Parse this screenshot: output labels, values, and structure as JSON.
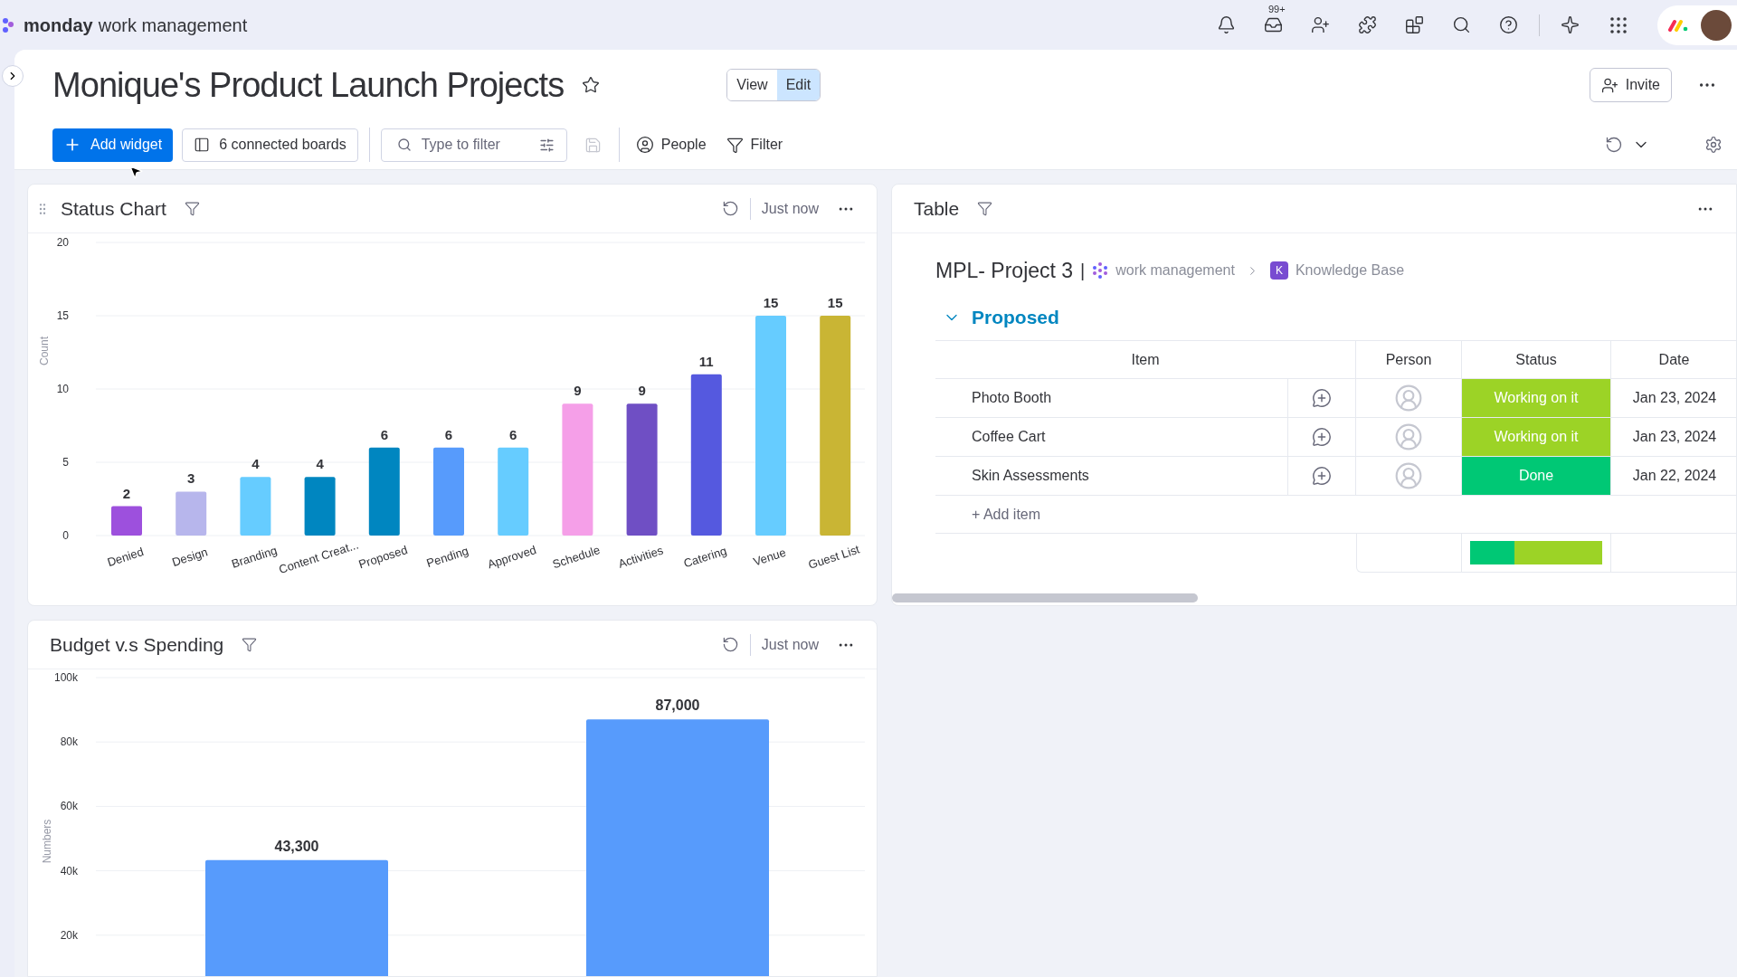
{
  "app": {
    "logo_bold": "monday",
    "logo_rest": "work management",
    "inbox_badge": "99+"
  },
  "board": {
    "title": "Monique's Product Launch Projects",
    "starred": false,
    "view_modes": [
      {
        "label": "View",
        "selected": false
      },
      {
        "label": "Edit",
        "selected": true
      }
    ],
    "invite": "Invite"
  },
  "toolbar": {
    "add_widget": "Add widget",
    "connected_boards": "6 connected boards",
    "filter_field": {
      "placeholder": "Type to filter"
    },
    "people": "People",
    "filter": "Filter"
  },
  "status_widget": {
    "title": "Status Chart",
    "updated": "Just now",
    "bars": [
      {
        "color": "#9d50dd"
      },
      {
        "color": "#b7b6ec"
      },
      {
        "color": "#66ccff"
      },
      {
        "color": "#0086c0"
      },
      {
        "color": "#0086c0"
      },
      {
        "color": "#579bfc"
      },
      {
        "color": "#66ccff"
      },
      {
        "color": "#f59fe8"
      },
      {
        "color": "#6f4fc4"
      },
      {
        "color": "#5559df"
      },
      {
        "color": "#66ccff"
      },
      {
        "color": "#c9b534"
      }
    ],
    "chart_data": {
      "type": "bar",
      "ylabel": "Count",
      "categories": [
        "Denied",
        "Design",
        "Branding",
        "Content Creat...",
        "Proposed",
        "Pending",
        "Approved",
        "Schedule",
        "Activities",
        "Catering",
        "Venue",
        "Guest List"
      ],
      "series": [
        {
          "values": [
            2,
            3,
            4,
            4,
            6,
            6,
            6,
            9,
            9,
            11,
            15,
            15
          ]
        }
      ],
      "ylim": [
        0,
        20
      ],
      "yticks": [
        0,
        5,
        10,
        15,
        20
      ],
      "grid": true,
      "data_labels": true
    }
  },
  "table_widget": {
    "title": "Table",
    "board_name": "MPL- Project 3",
    "separator": "|",
    "workspace": "work management",
    "folder_initial": "K",
    "folder": "Knowledge Base",
    "group": {
      "name": "Proposed",
      "expanded": true
    },
    "columns": [
      "Item",
      "Person",
      "Status",
      "Date"
    ],
    "rows": [
      {
        "item": "Photo Booth",
        "status": "Working on it",
        "color": "#9cd326",
        "date": "Jan 23, 2024"
      },
      {
        "item": "Coffee Cart",
        "status": "Working on it",
        "color": "#9cd326",
        "date": "Jan 23, 2024"
      },
      {
        "item": "Skin Assessments",
        "status": "Done",
        "color": "#00c875",
        "date": "Jan 22, 2024"
      }
    ],
    "add_item": "+ Add item"
  },
  "budget_widget": {
    "title": "Budget v.s Spending",
    "updated": "Just now",
    "chart_data": {
      "type": "bar",
      "ylabel": "Numbers",
      "series": [
        {
          "color": "#579bfc",
          "values": [
            43300,
            87000
          ]
        }
      ],
      "ylim": [
        0,
        100000
      ],
      "yticks": [
        {
          "value": 20000,
          "label": "20k"
        },
        {
          "value": 40000,
          "label": "40k"
        },
        {
          "value": 60000,
          "label": "60k"
        },
        {
          "value": 80000,
          "label": "80k"
        },
        {
          "value": 100000,
          "label": "100k"
        }
      ],
      "grid": true,
      "value_labels": [
        "43,300",
        "87,000"
      ]
    }
  }
}
